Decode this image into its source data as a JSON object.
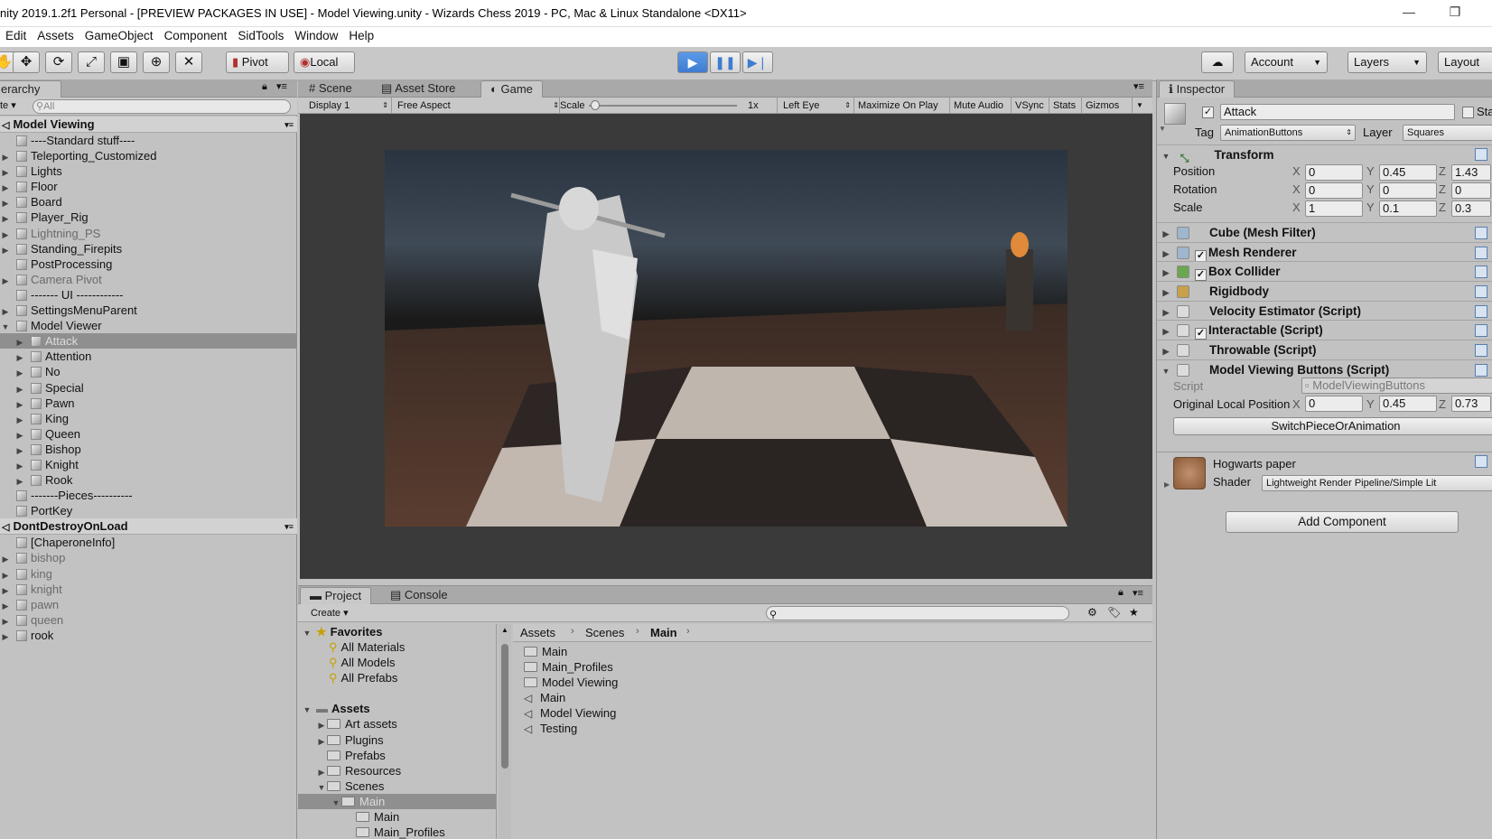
{
  "window": {
    "title": "nity 2019.1.2f1 Personal - [PREVIEW PACKAGES IN USE] - Model Viewing.unity - Wizards Chess 2019 - PC, Mac & Linux Standalone <DX11>"
  },
  "menu": [
    "Edit",
    "Assets",
    "GameObject",
    "Component",
    "SidTools",
    "Window",
    "Help"
  ],
  "toolbar": {
    "pivot": "Pivot",
    "local": "Local",
    "account": "Account",
    "layers": "Layers",
    "layout": "Layout"
  },
  "hierarchy": {
    "tab": "erarchy",
    "create": "te",
    "search_placeholder": "All",
    "scene1": "Model Viewing",
    "items": [
      {
        "label": "----Standard stuff----",
        "dim": false,
        "arrow": ""
      },
      {
        "label": "Teleporting_Customized",
        "dim": false,
        "arrow": "▶"
      },
      {
        "label": "Lights",
        "dim": false,
        "arrow": "▶"
      },
      {
        "label": "Floor",
        "dim": false,
        "arrow": "▶"
      },
      {
        "label": "Board",
        "dim": false,
        "arrow": "▶"
      },
      {
        "label": "Player_Rig",
        "dim": false,
        "arrow": "▶"
      },
      {
        "label": "Lightning_PS",
        "dim": true,
        "arrow": "▶"
      },
      {
        "label": "Standing_Firepits",
        "dim": false,
        "arrow": "▶"
      },
      {
        "label": "PostProcessing",
        "dim": false,
        "arrow": ""
      },
      {
        "label": "Camera Pivot",
        "dim": true,
        "arrow": "▶"
      },
      {
        "label": "------- UI ------------",
        "dim": false,
        "arrow": ""
      },
      {
        "label": "SettingsMenuParent",
        "dim": false,
        "arrow": "▶"
      },
      {
        "label": "Model Viewer",
        "dim": false,
        "arrow": "▼"
      }
    ],
    "children": [
      "Attack",
      "Attention",
      "No",
      "Special",
      "Pawn",
      "King",
      "Queen",
      "Bishop",
      "Knight",
      "Rook"
    ],
    "after_children": [
      "-------Pieces----------",
      "PortKey"
    ],
    "scene2": "DontDestroyOnLoad",
    "items2": [
      {
        "label": "[ChaperoneInfo]",
        "dim": false,
        "arrow": ""
      },
      {
        "label": "bishop",
        "dim": true,
        "arrow": "▶"
      },
      {
        "label": "king",
        "dim": true,
        "arrow": "▶"
      },
      {
        "label": "knight",
        "dim": true,
        "arrow": "▶"
      },
      {
        "label": "pawn",
        "dim": true,
        "arrow": "▶"
      },
      {
        "label": "queen",
        "dim": true,
        "arrow": "▶"
      },
      {
        "label": "rook",
        "dim": false,
        "arrow": "▶"
      }
    ]
  },
  "center_tabs": [
    "Scene",
    "Asset Store",
    "Game"
  ],
  "game_bar": {
    "display": "Display 1",
    "aspect": "Free Aspect",
    "scale_label": "Scale",
    "scale_value": "1x",
    "eye": "Left Eye",
    "maximize": "Maximize On Play",
    "mute": "Mute Audio",
    "vsync": "VSync",
    "stats": "Stats",
    "gizmos": "Gizmos"
  },
  "project": {
    "tabs": [
      "Project",
      "Console"
    ],
    "create": "Create",
    "favorites": "Favorites",
    "fav_items": [
      "All Materials",
      "All Models",
      "All Prefabs"
    ],
    "assets": "Assets",
    "asset_items": [
      {
        "label": "Art assets",
        "arrow": "▶",
        "indent": 1
      },
      {
        "label": "Plugins",
        "arrow": "▶",
        "indent": 1
      },
      {
        "label": "Prefabs",
        "arrow": "",
        "indent": 1
      },
      {
        "label": "Resources",
        "arrow": "▶",
        "indent": 1
      },
      {
        "label": "Scenes",
        "arrow": "▼",
        "indent": 1
      },
      {
        "label": "Main",
        "arrow": "▼",
        "indent": 2
      },
      {
        "label": "Main",
        "arrow": "",
        "indent": 3
      },
      {
        "label": "Main_Profiles",
        "arrow": "",
        "indent": 3
      }
    ],
    "breadcrumb": [
      "Assets",
      "Scenes",
      "Main"
    ],
    "files": [
      {
        "label": "Main",
        "type": "folder"
      },
      {
        "label": "Main_Profiles",
        "type": "folder"
      },
      {
        "label": "Model Viewing",
        "type": "folder"
      },
      {
        "label": "Main",
        "type": "scene"
      },
      {
        "label": "Model Viewing",
        "type": "scene"
      },
      {
        "label": "Testing",
        "type": "scene"
      }
    ]
  },
  "inspector": {
    "tab": "Inspector",
    "object_name": "Attack",
    "static_label": "Sta",
    "tag_label": "Tag",
    "tag_value": "AnimationButtons",
    "layer_label": "Layer",
    "layer_value": "Squares",
    "transform": {
      "title": "Transform",
      "position_label": "Position",
      "position": {
        "x": "0",
        "y": "0.45",
        "z": "1.43"
      },
      "rotation_label": "Rotation",
      "rotation": {
        "x": "0",
        "y": "0",
        "z": "0"
      },
      "scale_label": "Scale",
      "scale": {
        "x": "1",
        "y": "0.1",
        "z": "0.3"
      }
    },
    "components": [
      {
        "label": "Cube (Mesh Filter)",
        "checkbox": false,
        "icon_color": "#9fb6cf"
      },
      {
        "label": "Mesh Renderer",
        "checkbox": true,
        "icon_color": "#9fb6cf"
      },
      {
        "label": "Box Collider",
        "checkbox": true,
        "icon_color": "#6aa84f"
      },
      {
        "label": "Rigidbody",
        "checkbox": false,
        "icon_color": "#c9a04a"
      },
      {
        "label": "Velocity Estimator (Script)",
        "checkbox": false,
        "icon_color": "#dcdcdc"
      },
      {
        "label": "Interactable (Script)",
        "checkbox": true,
        "icon_color": "#dcdcdc"
      },
      {
        "label": "Throwable (Script)",
        "checkbox": false,
        "icon_color": "#dcdcdc"
      },
      {
        "label": "Model Viewing Buttons (Script)",
        "checkbox": false,
        "icon_color": "#dcdcdc"
      }
    ],
    "script_label": "Script",
    "script_value": "ModelViewingButtons",
    "olp_label": "Original Local Position",
    "olp": {
      "x": "0",
      "y": "0.45",
      "z": "0.73"
    },
    "switch_button": "SwitchPieceOrAnimation",
    "material_name": "Hogwarts paper",
    "shader_label": "Shader",
    "shader_value": "Lightweight Render Pipeline/Simple Lit",
    "add_component": "Add Component"
  }
}
